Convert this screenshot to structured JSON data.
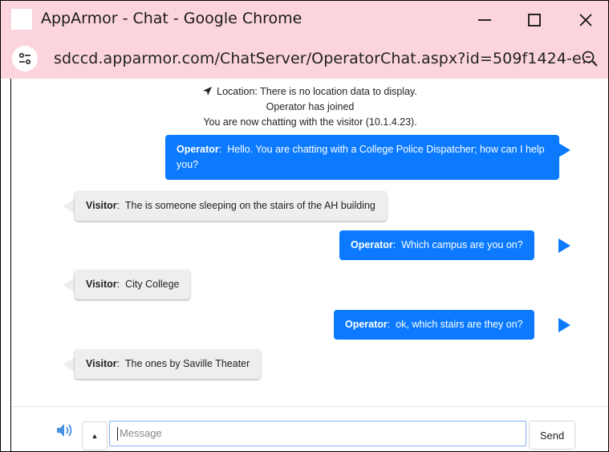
{
  "window": {
    "title": "AppArmor - Chat - Google Chrome",
    "url": "sdccd.apparmor.com/ChatServer/OperatorChat.aspx?id=509f1424-e…"
  },
  "colors": {
    "titlebar": "#fbd4dd",
    "operator_bubble": "#0b7aff",
    "visitor_bubble": "#eeeeee",
    "speaker_icon": "#4a90e2"
  },
  "icons": {
    "site_info": "tune-icon",
    "zoom": "zoom-icon",
    "location": "location-arrow-icon",
    "speaker": "speaker-icon",
    "caret": "caret-up-icon"
  },
  "system": {
    "location": "Location: There is no location data to display.",
    "joined": "Operator has joined",
    "chatting": "You are now chatting with the visitor (10.1.4.23)."
  },
  "messages": [
    {
      "sender": "Operator",
      "text": "Hello. You are chatting with a College Police Dispatcher; how can I help you?"
    },
    {
      "sender": "Visitor",
      "text": "The is someone sleeping on the stairs of the AH building"
    },
    {
      "sender": "Operator",
      "text": "Which campus are you on?"
    },
    {
      "sender": "Visitor",
      "text": "City College"
    },
    {
      "sender": "Operator",
      "text": "ok, which stairs are they on?"
    },
    {
      "sender": "Visitor",
      "text": "The ones by Saville Theater"
    }
  ],
  "composer": {
    "placeholder": "Message",
    "send_label": "Send"
  }
}
